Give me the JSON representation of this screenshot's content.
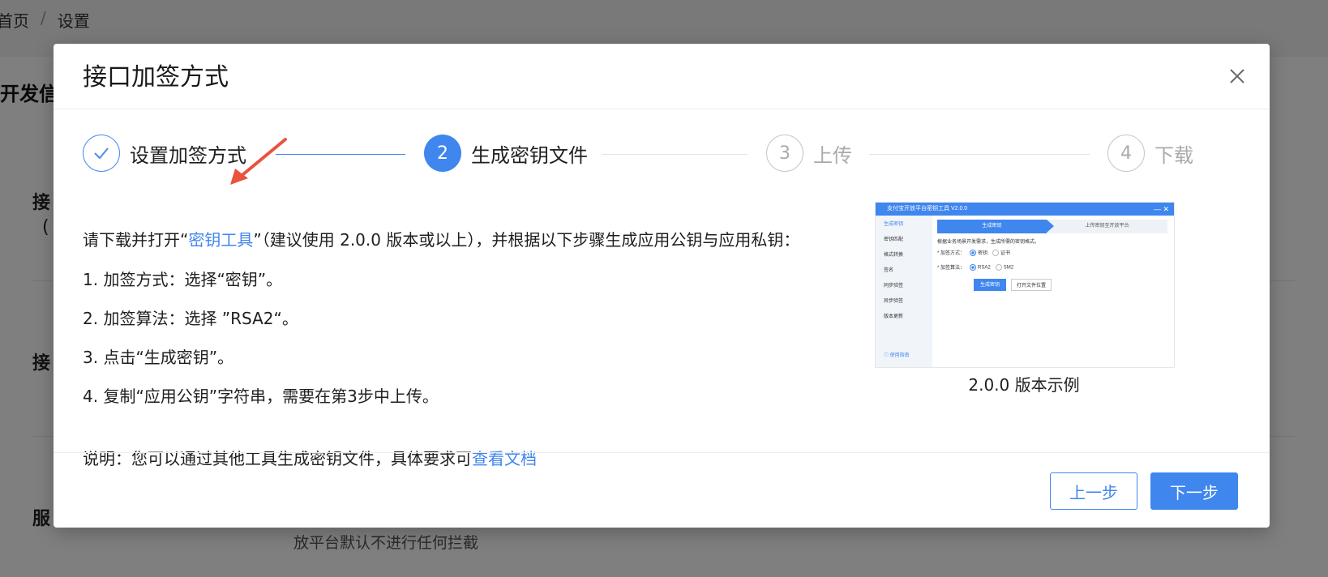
{
  "background": {
    "breadcrumb": {
      "home": "首页",
      "separator": "/",
      "current": "设置"
    },
    "section_title": "开发信",
    "labels": [
      "接",
      "(",
      "接",
      "服"
    ],
    "note": "放平台默认不进行任何拦截"
  },
  "modal": {
    "title": "接口加签方式",
    "steps": [
      {
        "number": "✓",
        "label": "设置加签方式",
        "state": "done"
      },
      {
        "number": "2",
        "label": "生成密钥文件",
        "state": "active"
      },
      {
        "number": "3",
        "label": "上传",
        "state": "todo"
      },
      {
        "number": "4",
        "label": "下载",
        "state": "todo"
      }
    ],
    "intro": {
      "prefix": "请下载并打开“",
      "link": "密钥工具",
      "suffix": "”（建议使用 2.0.0 版本或以上），并根据以下步骤生成应用公钥与应用私钥："
    },
    "instructions": [
      "1. 加签方式：选择“密钥”。",
      "2. 加签算法：选择 ”RSA2“。",
      "3. 点击“生成密钥”。",
      "4. 复制“应用公钥”字符串，需要在第3步中上传。"
    ],
    "note": {
      "prefix": "说明：您可以通过其他工具生成密钥文件，具体要求可",
      "link": "查看文档"
    },
    "example": {
      "window_title": "支付宝开放平台密钥工具 V2.0.0",
      "window_controls": "—  ✕",
      "sidebar": [
        "生成密钥",
        "密钥匹配",
        "格式转换",
        "签名",
        "同步验签",
        "异步验签",
        "版本更新"
      ],
      "sidebar_help": "ⓘ 使用指南",
      "tab_active": "生成密钥",
      "tab_next": "上传密钥至开放平台",
      "hint": "根据业务场景开发需求，生成所需的密钥格式。",
      "row1_label": "* 加签方式：",
      "row1_opt1": "密钥",
      "row1_opt2": "证书",
      "row2_label": "* 加签算法：",
      "row2_opt1": "RSA2",
      "row2_opt2": "SM2",
      "btn_generate": "生成密钥",
      "btn_open": "打开文件位置",
      "caption": "2.0.0 版本示例"
    },
    "buttons": {
      "prev": "上一步",
      "next": "下一步"
    }
  },
  "colors": {
    "primary": "#3f86ee",
    "annotation": "#e8543f",
    "overlay": "rgba(0,0,0,0.5)"
  }
}
